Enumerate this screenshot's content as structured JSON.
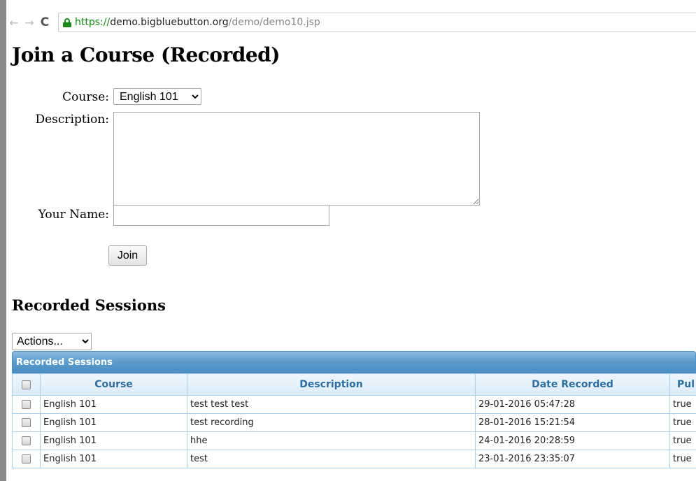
{
  "browser": {
    "url_scheme": "https://",
    "url_host": "demo.bigbluebutton.org",
    "url_path": "/demo/demo10.jsp",
    "back_glyph": "←",
    "forward_glyph": "→",
    "reload_glyph": "C"
  },
  "page": {
    "title": "Join a Course (Recorded)"
  },
  "form": {
    "course_label": "Course:",
    "course_value": "English 101",
    "description_label": "Description:",
    "description_value": "",
    "name_label": "Your Name:",
    "name_value": "",
    "join_label": "Join"
  },
  "recordings": {
    "section_title": "Recorded Sessions",
    "actions_value": "Actions...",
    "grid_caption": "Recorded Sessions",
    "columns": [
      "Course",
      "Description",
      "Date Recorded",
      "Pul"
    ],
    "rows": [
      {
        "course": "English 101",
        "description": "test test test",
        "date": "29-01-2016 05:47:28",
        "published": "true"
      },
      {
        "course": "English 101",
        "description": "test recording",
        "date": "28-01-2016 15:21:54",
        "published": "true"
      },
      {
        "course": "English 101",
        "description": "hhe",
        "date": "24-01-2016 20:28:59",
        "published": "true"
      },
      {
        "course": "English 101",
        "description": "test",
        "date": "23-01-2016 23:35:07",
        "published": "true"
      }
    ]
  },
  "colors": {
    "grid_header": "#5c9ccc",
    "column_header_text": "#2e6e9e",
    "lock": "#1b8a1b"
  }
}
